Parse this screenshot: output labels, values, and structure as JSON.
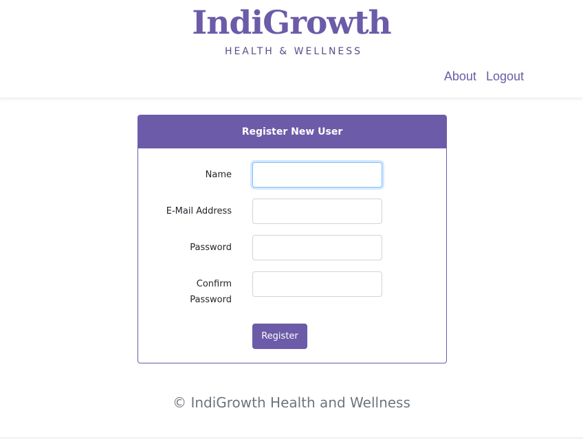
{
  "colors": {
    "brand": "#6b5ba8",
    "logo_subtitle": "#5a4d8a",
    "link": "#6b5ba8",
    "footer_text": "#6c757d"
  },
  "logo": {
    "title": "IndiGrowth",
    "subtitle": "HEALTH & WELLNESS"
  },
  "nav": {
    "about": "About",
    "logout": "Logout"
  },
  "form": {
    "header": "Register New User",
    "fields": [
      {
        "label": "Name",
        "value": ""
      },
      {
        "label": "E-Mail Address",
        "value": ""
      },
      {
        "label": "Password",
        "value": ""
      },
      {
        "label": "Confirm Password",
        "value": ""
      }
    ],
    "submit_label": "Register"
  },
  "footer": {
    "text": "© IndiGrowth Health and Wellness"
  }
}
